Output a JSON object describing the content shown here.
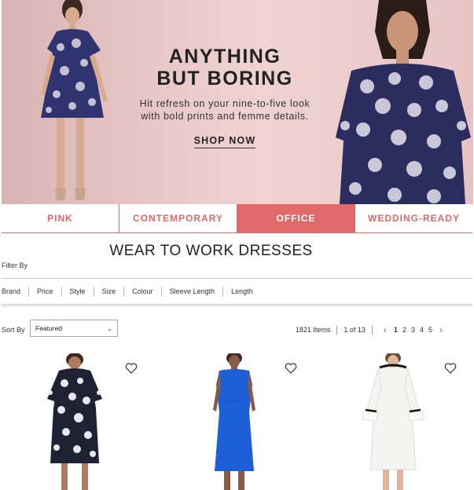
{
  "hero": {
    "headline_1": "ANYTHING",
    "headline_2": "BUT BORING",
    "sub_1": "Hit refresh on your nine-to-five look",
    "sub_2": "with bold prints and femme details.",
    "shop_label": "SHOP NOW"
  },
  "tabs": [
    {
      "label": "PINK",
      "active": false
    },
    {
      "label": "CONTEMPORARY",
      "active": false
    },
    {
      "label": "OFFICE",
      "active": true
    },
    {
      "label": "WEDDING-READY",
      "active": false
    }
  ],
  "page_title": "WEAR TO WORK DRESSES",
  "filter_by_label": "Filter By",
  "filters": [
    "Brand",
    "Price",
    "Style",
    "Size",
    "Colour",
    "Sleeve Length",
    "Length"
  ],
  "sort": {
    "label": "Sort By",
    "selected": "Featured"
  },
  "pagination": {
    "items": "1821 Items",
    "page_of": "1 of 13",
    "pages": [
      "1",
      "2",
      "3",
      "4",
      "5"
    ],
    "current": "1"
  },
  "products": [
    {
      "icon": "floral-dress-image",
      "wishlist_icon": "heart-icon"
    },
    {
      "icon": "blue-sheath-dress-image",
      "wishlist_icon": "heart-icon"
    },
    {
      "icon": "white-bell-sleeve-dress-image",
      "wishlist_icon": "heart-icon"
    }
  ],
  "colors": {
    "accent": "#e2696a",
    "hero_bg": "#ebcccb",
    "blue_dress": "#1c5fd6",
    "navy_print": "#2b2d5e"
  }
}
